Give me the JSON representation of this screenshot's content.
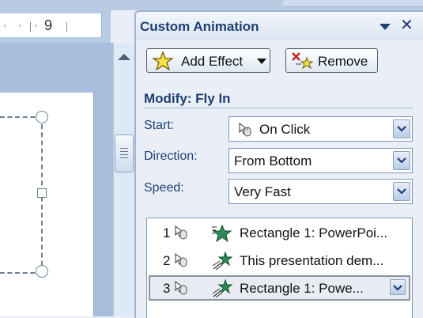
{
  "ruler": {
    "dots": "· · · ·",
    "number": "9"
  },
  "pane": {
    "title": "Custom Animation",
    "add_effect_label": "Add Effect",
    "remove_label": "Remove",
    "modify_title": "Modify: Fly In",
    "start": {
      "label": "Start:",
      "value": "On Click",
      "icon": "mouse-icon"
    },
    "direction": {
      "label": "Direction:",
      "value": "From Bottom"
    },
    "speed": {
      "label": "Speed:",
      "value": "Very Fast"
    }
  },
  "animation_list": [
    {
      "number": "1",
      "trigger_icon": "mouse-icon",
      "effect_icon": "entrance-star-icon",
      "text": "Rectangle 1: PowerPoi...",
      "selected": false
    },
    {
      "number": "2",
      "trigger_icon": "mouse-icon",
      "effect_icon": "fly-in-star-icon",
      "text": "This presentation dem...",
      "selected": false
    },
    {
      "number": "3",
      "trigger_icon": "mouse-icon",
      "effect_icon": "fly-in-star-icon",
      "text": "Rectangle 1: Powe...",
      "selected": true
    }
  ],
  "colors": {
    "pane_title": "#1d3f72",
    "pane_background": "#e9eef7",
    "workspace": "#a7bfdd",
    "star_green": "#2e8b57"
  }
}
